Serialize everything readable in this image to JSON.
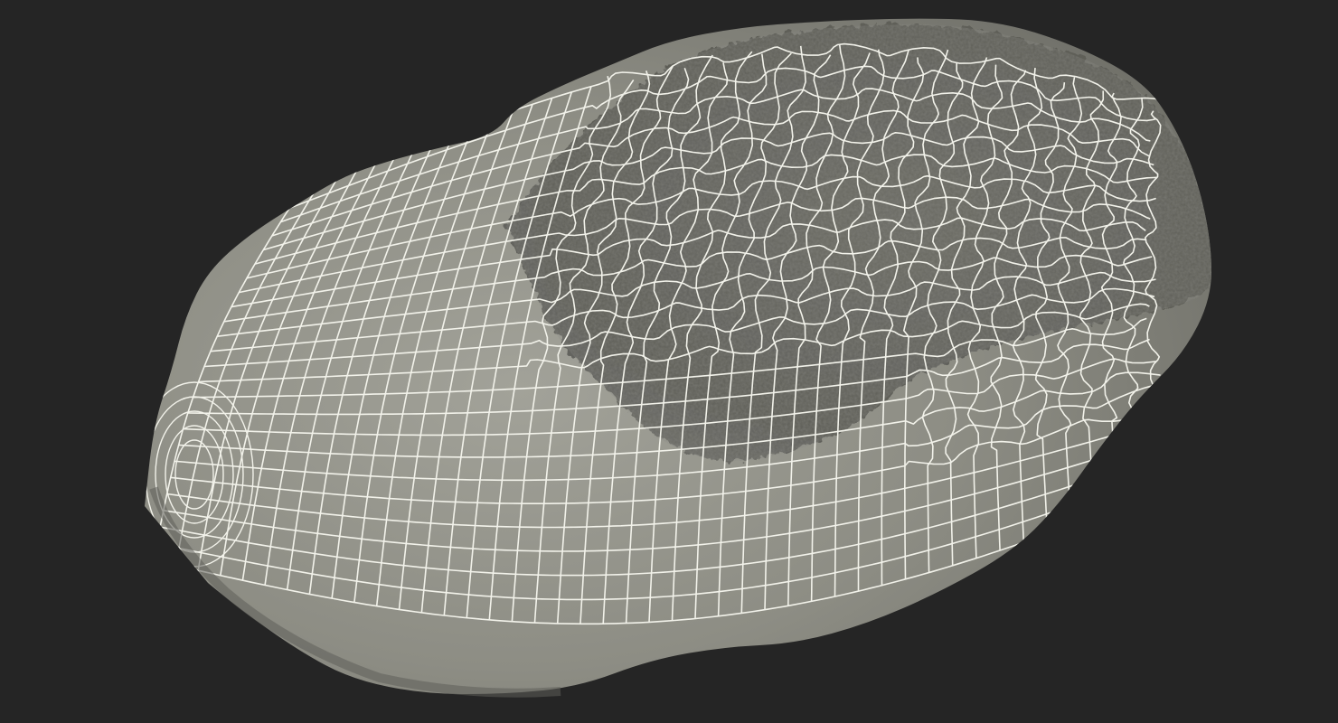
{
  "viewport": {
    "background_color": "#252525",
    "object": {
      "name": "wireframe-scanned-object",
      "surface_color": "#8b8b82",
      "surface_highlight_color": "#9c9c92",
      "rough_region_color": "#6e6e67",
      "wire_color": "#f2f2ea",
      "display_mode": "wireframe-on-shaded"
    }
  }
}
